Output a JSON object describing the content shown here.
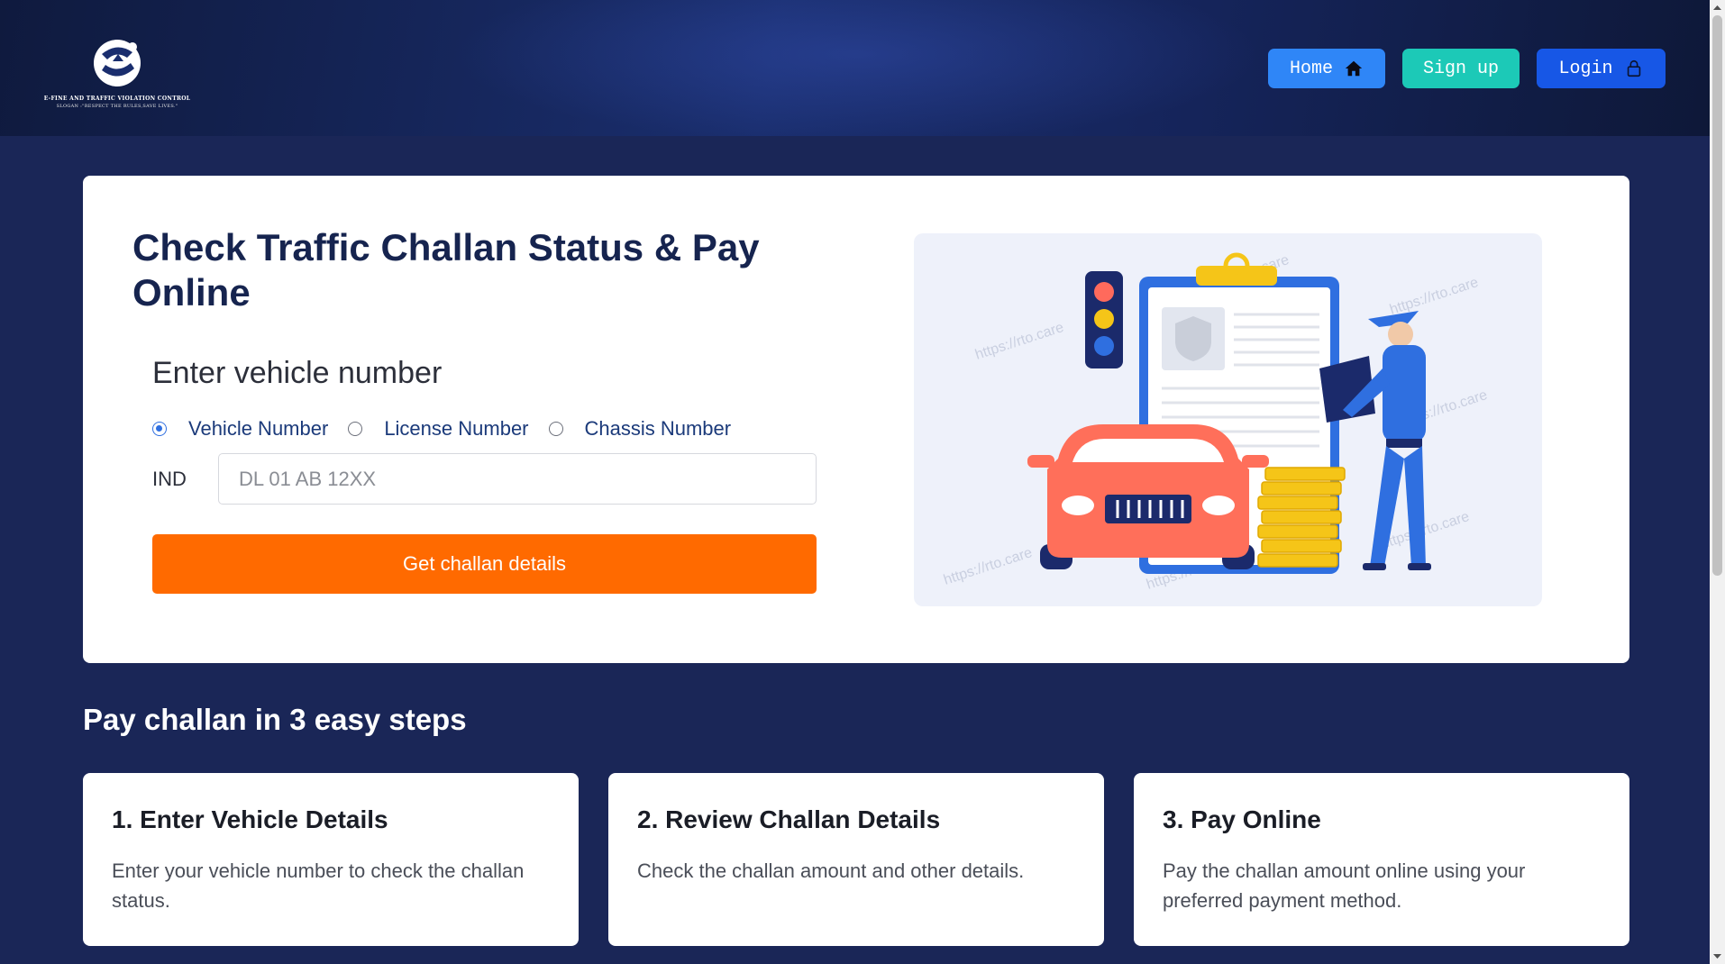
{
  "header": {
    "logo_line1": "E-FINE AND TRAFFIC VIOLATION CONTROL",
    "logo_line2": "SLOGAN :\"RESPECT THE RULES,SAVE LIVES.\"",
    "nav": {
      "home_label": "Home",
      "signup_label": "Sign up",
      "login_label": "Login"
    }
  },
  "hero": {
    "title": "Check Traffic Challan Status & Pay Online",
    "subtitle": "Enter vehicle number",
    "radio_options": [
      "Vehicle Number",
      "License Number",
      "Chassis Number"
    ],
    "selected_option": "Vehicle Number",
    "prefix": "IND",
    "input_placeholder": "DL 01 AB 12XX",
    "input_value": "",
    "submit_label": "Get challan details",
    "illustration_watermark": "https://rto.care"
  },
  "steps": {
    "title": "Pay challan in 3 easy steps",
    "items": [
      {
        "title": "1. Enter Vehicle Details",
        "desc": "Enter your vehicle number to check the challan status."
      },
      {
        "title": "2. Review Challan Details",
        "desc": "Check the challan amount and other details."
      },
      {
        "title": "3. Pay Online",
        "desc": "Pay the challan amount online using your preferred payment method."
      }
    ]
  },
  "colors": {
    "page_bg": "#1a2657",
    "accent_orange": "#ff6a00",
    "home_btn": "#2f86f7",
    "signup_btn": "#1cc9b7",
    "login_btn": "#1757e6",
    "title_text": "#16244f"
  },
  "icons": {
    "home": "home-icon",
    "login": "lock-icon"
  }
}
